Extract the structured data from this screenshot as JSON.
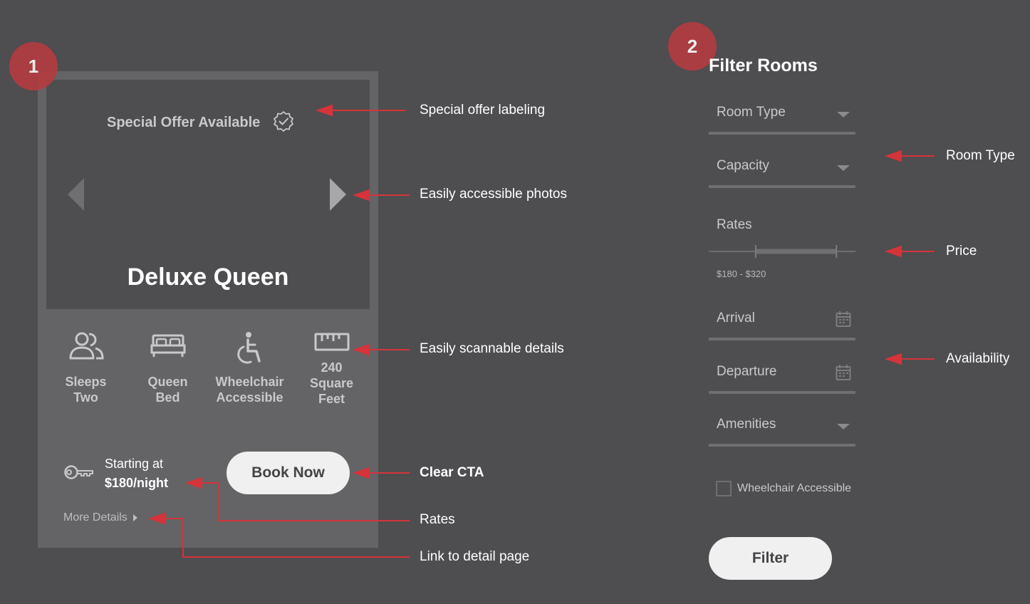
{
  "badges": {
    "step1": "1",
    "step2": "2"
  },
  "card": {
    "offer_label": "Special Offer Available",
    "room_name": "Deluxe Queen",
    "features": [
      {
        "icon": "people-icon",
        "line1": "Sleeps",
        "line2": "Two",
        "line3": ""
      },
      {
        "icon": "bed-icon",
        "line1": "Queen",
        "line2": "Bed",
        "line3": ""
      },
      {
        "icon": "wheelchair-icon",
        "line1": "Wheelchair",
        "line2": "Accessible",
        "line3": ""
      },
      {
        "icon": "ruler-icon",
        "line1": "240",
        "line2": "Square",
        "line3": "Feet"
      }
    ],
    "price_prefix": "Starting at",
    "price_amount": "$180/night",
    "book_label": "Book Now",
    "more_details": "More Details"
  },
  "annotations": {
    "special_offer": "Special offer labeling",
    "photos": "Easily accessible photos",
    "details": "Easily scannable details",
    "cta": "Clear CTA",
    "rates": "Rates",
    "link": "Link to detail page",
    "room_type": "Room Type",
    "price": "Price",
    "availability": "Availability"
  },
  "filter": {
    "title": "Filter Rooms",
    "room_type": "Room Type",
    "capacity": "Capacity",
    "rates_label": "Rates",
    "rates_value": "$180 - $320",
    "rate_min_fraction": 0.32,
    "rate_max_fraction": 0.87,
    "arrival": "Arrival",
    "departure": "Departure",
    "amenities": "Amenities",
    "wheelchair_label": "Wheelchair Accessible",
    "filter_button": "Filter"
  },
  "colors": {
    "background": "#4e4d50",
    "card": "#646366",
    "accent_red": "#b53c40",
    "annotation_red": "#d4343a",
    "button": "#f0f0f0"
  }
}
